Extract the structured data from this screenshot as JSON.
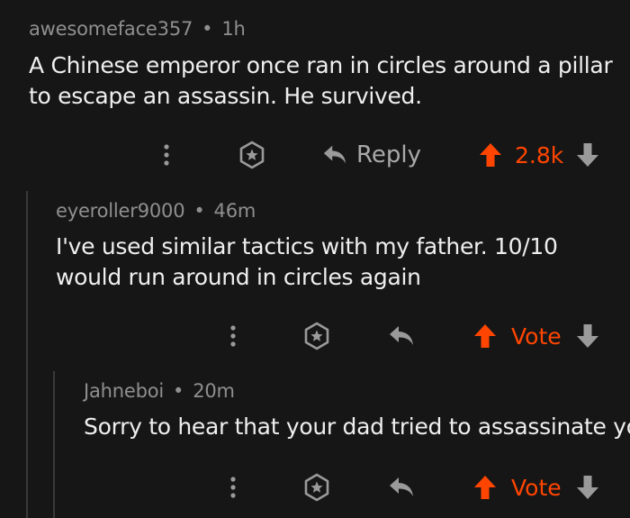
{
  "colors": {
    "background": "#161616",
    "upvote": "#ff4500",
    "muted": "#8f8f8f",
    "icon": "#9a9a9a"
  },
  "comments": [
    {
      "author": "awesomeface357",
      "age": "1h",
      "text": "A Chinese emperor once ran in circles around a pillar to escape an assassin.  He survived.",
      "actions": {
        "reply_label": "Reply",
        "score": "2.8k"
      }
    },
    {
      "author": "eyeroller9000",
      "age": "46m",
      "text": "I've used similar tactics with my father. 10/10 would run around in circles again",
      "actions": {
        "score": "Vote"
      }
    },
    {
      "author": "Jahneboi",
      "age": "20m",
      "text": "Sorry to hear that your dad tried to assassinate you",
      "actions": {
        "score": "Vote"
      }
    }
  ],
  "separator": "•",
  "icons": [
    "more-vertical-icon",
    "award-icon",
    "reply-icon",
    "upvote-icon",
    "downvote-icon"
  ]
}
